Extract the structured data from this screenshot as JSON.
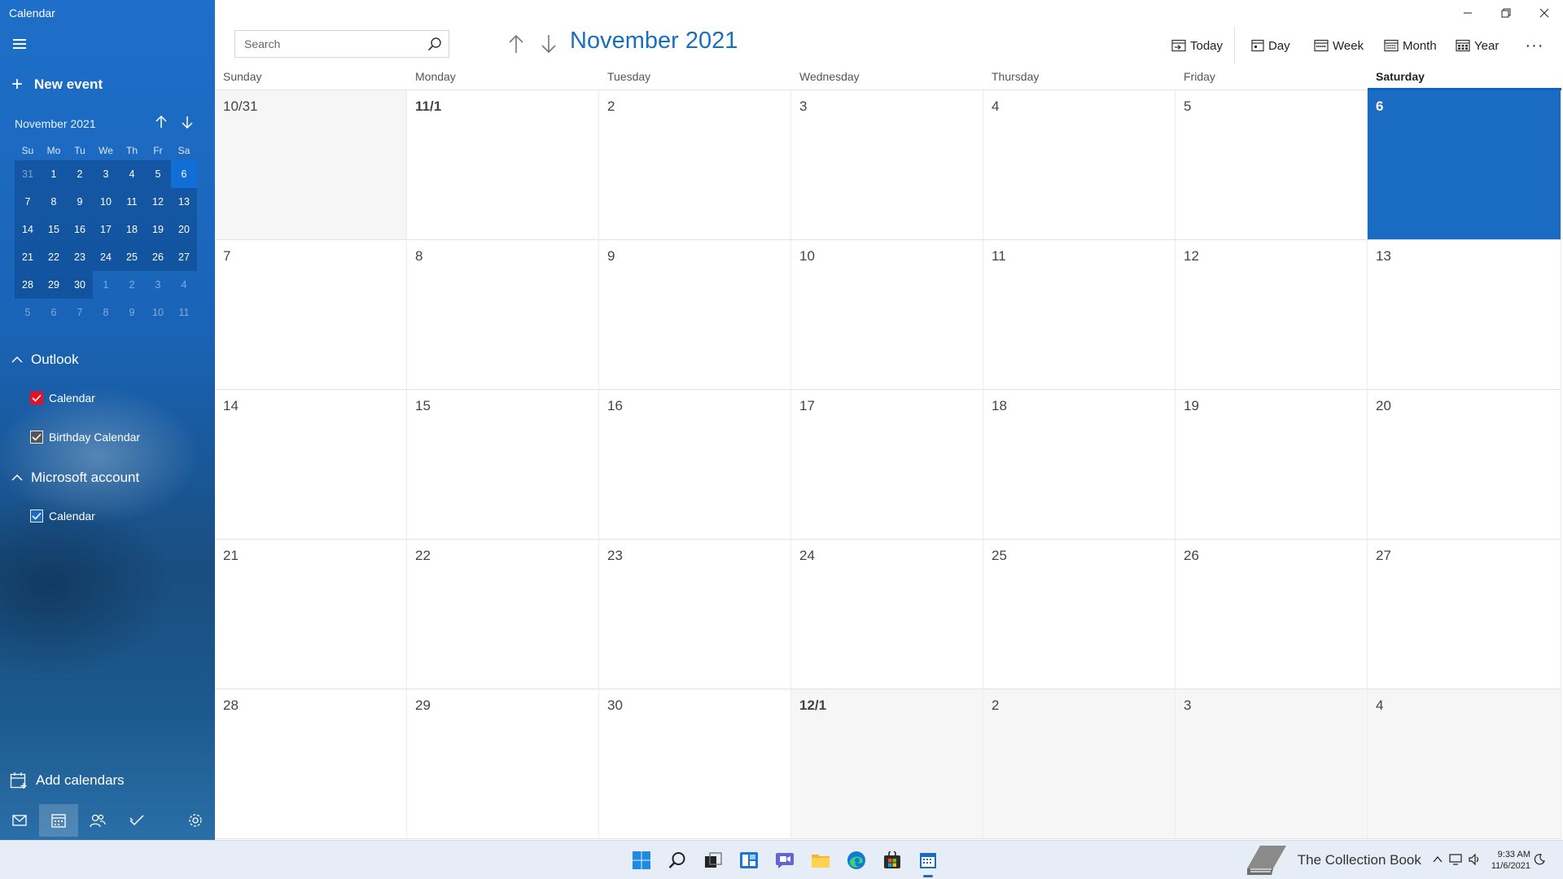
{
  "window": {
    "title": "Calendar"
  },
  "sidebar": {
    "new_event_label": "New event",
    "mini_calendar": {
      "title": "November 2021",
      "weekdays": [
        "Su",
        "Mo",
        "Tu",
        "We",
        "Th",
        "Fr",
        "Sa"
      ],
      "weeks": [
        [
          "31",
          "1",
          "2",
          "3",
          "4",
          "5",
          "6"
        ],
        [
          "7",
          "8",
          "9",
          "10",
          "11",
          "12",
          "13"
        ],
        [
          "14",
          "15",
          "16",
          "17",
          "18",
          "19",
          "20"
        ],
        [
          "21",
          "22",
          "23",
          "24",
          "25",
          "26",
          "27"
        ],
        [
          "28",
          "29",
          "30",
          "1",
          "2",
          "3",
          "4"
        ],
        [
          "5",
          "6",
          "7",
          "8",
          "9",
          "10",
          "11"
        ]
      ]
    },
    "groups": [
      {
        "label": "Outlook",
        "calendars": [
          {
            "label": "Calendar",
            "checked": true,
            "color": "#e81123"
          },
          {
            "label": "Birthday Calendar",
            "checked": true,
            "color": "#555555"
          }
        ]
      },
      {
        "label": "Microsoft account",
        "calendars": [
          {
            "label": "Calendar",
            "checked": true,
            "color": "#1a6bc2"
          }
        ]
      }
    ],
    "add_calendars_label": "Add calendars",
    "bottom_nav": [
      "mail-icon",
      "calendar-icon",
      "people-icon",
      "todo-icon",
      "settings-icon"
    ]
  },
  "search": {
    "placeholder": "Search"
  },
  "header": {
    "month_title": "November 2021"
  },
  "toolbar": {
    "today_label": "Today",
    "day_label": "Day",
    "week_label": "Week",
    "month_label": "Month",
    "year_label": "Year",
    "more_label": "···"
  },
  "month_view": {
    "weekday_headers": [
      "Sunday",
      "Monday",
      "Tuesday",
      "Wednesday",
      "Thursday",
      "Friday",
      "Saturday"
    ],
    "weeks": [
      [
        "10/31",
        "11/1",
        "2",
        "3",
        "4",
        "5",
        "6"
      ],
      [
        "7",
        "8",
        "9",
        "10",
        "11",
        "12",
        "13"
      ],
      [
        "14",
        "15",
        "16",
        "17",
        "18",
        "19",
        "20"
      ],
      [
        "21",
        "22",
        "23",
        "24",
        "25",
        "26",
        "27"
      ],
      [
        "28",
        "29",
        "30",
        "12/1",
        "2",
        "3",
        "4"
      ]
    ]
  },
  "taskbar": {
    "apps": [
      "start-icon",
      "search-icon",
      "task-view-icon",
      "widgets-icon",
      "chat-icon",
      "file-explorer-icon",
      "edge-icon",
      "store-icon",
      "calendar-app-icon"
    ],
    "tray": {
      "brand": "The Collection Book",
      "time": "9:33 AM",
      "date": "11/6/2021"
    }
  },
  "colors": {
    "accent": "#1a6bc2",
    "today_cell": "#1a6bc2",
    "outlook_calendar": "#e81123"
  }
}
